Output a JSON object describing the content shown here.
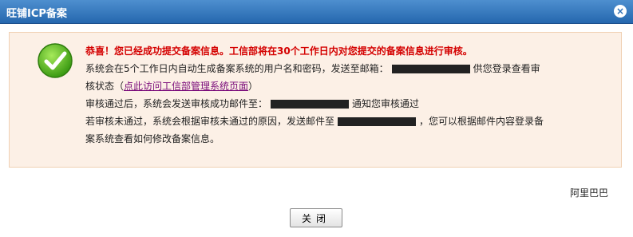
{
  "window": {
    "title": "旺铺ICP备案",
    "close_symbol": "×"
  },
  "message": {
    "headline": "恭喜！您已经成功提交备案信息。工信部将在30个工作日内对您提交的备案信息进行审核。",
    "line1_prefix": "系统会在5个工作日内自动生成备案系统的用户名和密码，发送至邮箱：",
    "line1_suffix": "供您登录查看审",
    "line2_prefix": "核状态（",
    "line2_link": "点此访问工信部管理系统页面",
    "line2_suffix": "）",
    "line3_prefix": "审核通过后，系统会发送审核成功邮件至：",
    "line3_suffix": "通知您审核通过",
    "line4_prefix": "若审核未通过，系统会根据审核未通过的原因，发送邮件至",
    "line4_suffix": "，您可以根据邮件内容登录备",
    "line5": "案系统查看如何修改备案信息。"
  },
  "signature": "阿里巴巴",
  "buttons": {
    "close_label": "关闭"
  },
  "icons": {
    "status": "check-circle-icon"
  },
  "colors": {
    "title_bar": "#2e6fb5",
    "headline": "#d40000",
    "link": "#7a0b7a",
    "message_bg": "#fcf0e6"
  }
}
